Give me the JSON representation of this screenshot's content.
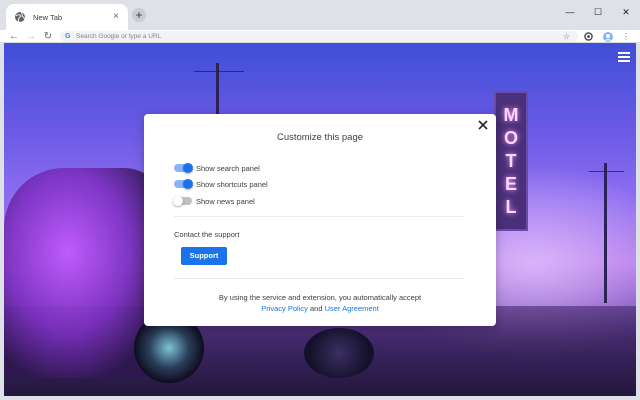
{
  "tab": {
    "title": "New Tab",
    "close": "×",
    "new_tab": "+"
  },
  "window": {
    "minimize": "—",
    "maximize": "☐",
    "close": "✕"
  },
  "toolbar": {
    "back": "←",
    "forward": "→",
    "reload": "↻",
    "omnibox_g": "G",
    "omnibox_placeholder": "Search Google or type a URL",
    "star": "☆",
    "menu": "⋮"
  },
  "scene": {
    "sign_letters": [
      "M",
      "O",
      "T",
      "E",
      "L"
    ]
  },
  "modal": {
    "title": "Customize this page",
    "toggles": [
      {
        "label": "Show search panel",
        "on": true
      },
      {
        "label": "Show shortcuts panel",
        "on": true
      },
      {
        "label": "Show news panel",
        "on": false
      }
    ],
    "contact_label": "Contact the support",
    "support_button": "Support",
    "footer_text": "By using the service and extension, you automatically accept",
    "privacy_link": "Privacy Policy",
    "and_text": "and",
    "agreement_link": "User Agreement"
  },
  "colors": {
    "accent": "#1a73e8",
    "toggle_track_on": "#8ab4f8"
  }
}
